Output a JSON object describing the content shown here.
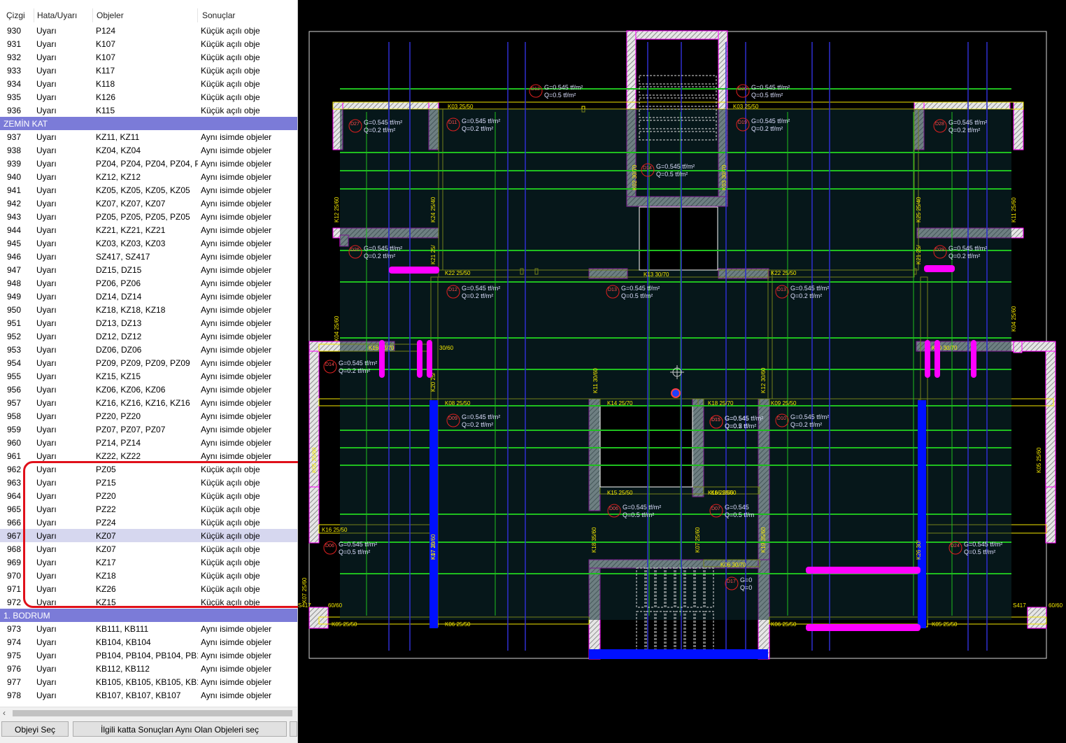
{
  "table": {
    "headers": [
      "Çizgi",
      "Hata/Uyarı",
      "Objeler",
      "Sonuçlar"
    ],
    "rows": [
      {
        "no": "930",
        "type": "Uyarı",
        "objects": "P124",
        "result": "Küçük açılı obje"
      },
      {
        "no": "931",
        "type": "Uyarı",
        "objects": "K107",
        "result": "Küçük açılı obje"
      },
      {
        "no": "932",
        "type": "Uyarı",
        "objects": "K107",
        "result": "Küçük açılı obje"
      },
      {
        "no": "933",
        "type": "Uyarı",
        "objects": "K117",
        "result": "Küçük açılı obje"
      },
      {
        "no": "934",
        "type": "Uyarı",
        "objects": "K118",
        "result": "Küçük açılı obje"
      },
      {
        "no": "935",
        "type": "Uyarı",
        "objects": "K126",
        "result": "Küçük açılı obje"
      },
      {
        "no": "936",
        "type": "Uyarı",
        "objects": "K115",
        "result": "Küçük açılı obje"
      },
      {
        "group": "ZEMİN KAT"
      },
      {
        "no": "937",
        "type": "Uyarı",
        "objects": "KZ11, KZ11",
        "result": "Aynı isimde objeler"
      },
      {
        "no": "938",
        "type": "Uyarı",
        "objects": "KZ04, KZ04",
        "result": "Aynı isimde objeler"
      },
      {
        "no": "939",
        "type": "Uyarı",
        "objects": "PZ04, PZ04, PZ04, PZ04, P...",
        "result": "Aynı isimde objeler"
      },
      {
        "no": "940",
        "type": "Uyarı",
        "objects": "KZ12, KZ12",
        "result": "Aynı isimde objeler"
      },
      {
        "no": "941",
        "type": "Uyarı",
        "objects": "KZ05, KZ05, KZ05, KZ05",
        "result": "Aynı isimde objeler"
      },
      {
        "no": "942",
        "type": "Uyarı",
        "objects": "KZ07, KZ07, KZ07",
        "result": "Aynı isimde objeler"
      },
      {
        "no": "943",
        "type": "Uyarı",
        "objects": "PZ05, PZ05, PZ05, PZ05",
        "result": "Aynı isimde objeler"
      },
      {
        "no": "944",
        "type": "Uyarı",
        "objects": "KZ21, KZ21, KZ21",
        "result": "Aynı isimde objeler"
      },
      {
        "no": "945",
        "type": "Uyarı",
        "objects": "KZ03, KZ03, KZ03",
        "result": "Aynı isimde objeler"
      },
      {
        "no": "946",
        "type": "Uyarı",
        "objects": "SZ417, SZ417",
        "result": "Aynı isimde objeler"
      },
      {
        "no": "947",
        "type": "Uyarı",
        "objects": "DZ15, DZ15",
        "result": "Aynı isimde objeler"
      },
      {
        "no": "948",
        "type": "Uyarı",
        "objects": "PZ06, PZ06",
        "result": "Aynı isimde objeler"
      },
      {
        "no": "949",
        "type": "Uyarı",
        "objects": "DZ14, DZ14",
        "result": "Aynı isimde objeler"
      },
      {
        "no": "950",
        "type": "Uyarı",
        "objects": "KZ18, KZ18, KZ18",
        "result": "Aynı isimde objeler"
      },
      {
        "no": "951",
        "type": "Uyarı",
        "objects": "DZ13, DZ13",
        "result": "Aynı isimde objeler"
      },
      {
        "no": "952",
        "type": "Uyarı",
        "objects": "DZ12, DZ12",
        "result": "Aynı isimde objeler"
      },
      {
        "no": "953",
        "type": "Uyarı",
        "objects": "DZ06, DZ06",
        "result": "Aynı isimde objeler"
      },
      {
        "no": "954",
        "type": "Uyarı",
        "objects": "PZ09, PZ09, PZ09, PZ09",
        "result": "Aynı isimde objeler"
      },
      {
        "no": "955",
        "type": "Uyarı",
        "objects": "KZ15, KZ15",
        "result": "Aynı isimde objeler"
      },
      {
        "no": "956",
        "type": "Uyarı",
        "objects": "KZ06, KZ06, KZ06",
        "result": "Aynı isimde objeler"
      },
      {
        "no": "957",
        "type": "Uyarı",
        "objects": "KZ16, KZ16, KZ16, KZ16",
        "result": "Aynı isimde objeler"
      },
      {
        "no": "958",
        "type": "Uyarı",
        "objects": "PZ20, PZ20",
        "result": "Aynı isimde objeler"
      },
      {
        "no": "959",
        "type": "Uyarı",
        "objects": "PZ07, PZ07, PZ07",
        "result": "Aynı isimde objeler"
      },
      {
        "no": "960",
        "type": "Uyarı",
        "objects": "PZ14, PZ14",
        "result": "Aynı isimde objeler"
      },
      {
        "no": "961",
        "type": "Uyarı",
        "objects": "KZ22, KZ22",
        "result": "Aynı isimde objeler"
      },
      {
        "no": "962",
        "type": "Uyarı",
        "objects": "PZ05",
        "result": "Küçük açılı obje"
      },
      {
        "no": "963",
        "type": "Uyarı",
        "objects": "PZ15",
        "result": "Küçük açılı obje"
      },
      {
        "no": "964",
        "type": "Uyarı",
        "objects": "PZ20",
        "result": "Küçük açılı obje"
      },
      {
        "no": "965",
        "type": "Uyarı",
        "objects": "PZ22",
        "result": "Küçük açılı obje"
      },
      {
        "no": "966",
        "type": "Uyarı",
        "objects": "PZ24",
        "result": "Küçük açılı obje"
      },
      {
        "no": "967",
        "type": "Uyarı",
        "objects": "KZ07",
        "result": "Küçük açılı obje",
        "selected": true
      },
      {
        "no": "968",
        "type": "Uyarı",
        "objects": "KZ07",
        "result": "Küçük açılı obje"
      },
      {
        "no": "969",
        "type": "Uyarı",
        "objects": "KZ17",
        "result": "Küçük açılı obje"
      },
      {
        "no": "970",
        "type": "Uyarı",
        "objects": "KZ18",
        "result": "Küçük açılı obje"
      },
      {
        "no": "971",
        "type": "Uyarı",
        "objects": "KZ26",
        "result": "Küçük açılı obje"
      },
      {
        "no": "972",
        "type": "Uyarı",
        "objects": "KZ15",
        "result": "Küçük açılı obje"
      },
      {
        "group": "1. BODRUM"
      },
      {
        "no": "973",
        "type": "Uyarı",
        "objects": "KB111, KB111",
        "result": "Aynı isimde objeler"
      },
      {
        "no": "974",
        "type": "Uyarı",
        "objects": "KB104, KB104",
        "result": "Aynı isimde objeler"
      },
      {
        "no": "975",
        "type": "Uyarı",
        "objects": "PB104, PB104, PB104, PB1...",
        "result": "Aynı isimde objeler"
      },
      {
        "no": "976",
        "type": "Uyarı",
        "objects": "KB112, KB112",
        "result": "Aynı isimde objeler"
      },
      {
        "no": "977",
        "type": "Uyarı",
        "objects": "KB105, KB105, KB105, KB105",
        "result": "Aynı isimde objeler"
      },
      {
        "no": "978",
        "type": "Uyarı",
        "objects": "KB107, KB107, KB107",
        "result": "Aynı isimde objeler"
      }
    ]
  },
  "scrollbar": {
    "left_arrow": "‹"
  },
  "buttons": {
    "select_object": "Objeyi Seç",
    "select_same_results": "İlgili katta Sonuçları Aynı Olan Objeleri seç"
  },
  "cad": {
    "beams": [
      {
        "name": "K03 25/50",
        "color": "#f4e800"
      },
      {
        "name": "K03 25/50",
        "color": "#f4e800"
      },
      {
        "name": "K22 25/50",
        "color": "#f4e800"
      },
      {
        "name": "K13 30/70",
        "color": "#f4e800"
      },
      {
        "name": "K22 25/50",
        "color": "#f4e800"
      },
      {
        "name": "K16 30/70",
        "color": "#f4e800"
      },
      {
        "name": "30/60",
        "color": "#f4e800"
      },
      {
        "name": "K08 25/50",
        "color": "#f4e800"
      },
      {
        "name": "K14 25/70",
        "color": "#f4e800"
      },
      {
        "name": "K18 25/70",
        "color": "#f4e800"
      },
      {
        "name": "K09 25/50",
        "color": "#f4e800"
      },
      {
        "name": "K15 25/50",
        "color": "#f4e800"
      },
      {
        "name": "K16 25/50",
        "color": "#f4e800"
      },
      {
        "name": "K16 25/50",
        "color": "#f4e800"
      },
      {
        "name": "K16 25/50",
        "color": "#f4e800"
      },
      {
        "name": "K06 30/70",
        "color": "#f4e800"
      },
      {
        "name": "K05 25/50",
        "color": "#f4e800"
      },
      {
        "name": "K06 25/50",
        "color": "#f4e800"
      },
      {
        "name": "K06 25/50",
        "color": "#f4e800"
      },
      {
        "name": "K05 25/50",
        "color": "#f4e800"
      },
      {
        "name": "K30 30/70",
        "color": "#f4e800"
      }
    ],
    "side_labels": [
      {
        "text": "S417"
      },
      {
        "text": "60/60"
      },
      {
        "text": "S417"
      },
      {
        "text": "60/60"
      }
    ],
    "slabs": [
      {
        "id": "D12",
        "g": "G=0.545  tf/m²",
        "q": "Q=0.5  tf/m²"
      },
      {
        "id": "D20",
        "g": "G=0.545  tf/m²",
        "q": "Q=0.5  tf/m²"
      },
      {
        "id": "D27",
        "g": "G=0.545  tf/m²",
        "q": "Q=0.2  tf/m²"
      },
      {
        "id": "D11",
        "g": "G=0.545  tf/m²",
        "q": "Q=0.2  tf/m²"
      },
      {
        "id": "D19",
        "g": "G=0.545  tf/m²",
        "q": "Q=0.2  tf/m²"
      },
      {
        "id": "D28",
        "g": "G=0.545  tf/m²",
        "q": "Q=0.2  tf/m²"
      },
      {
        "id": "D14",
        "g": "G=0.545  tf/m²",
        "q": "Q=0.5  tf/m²"
      },
      {
        "id": "D26",
        "g": "G=0.545  tf/m²",
        "q": "Q=0.2  tf/m²"
      },
      {
        "id": "D29",
        "g": "G=0.545  tf/m²",
        "q": "Q=0.2  tf/m²"
      },
      {
        "id": "D12",
        "g": "G=0.545  tf/m²",
        "q": "Q=0.2  tf/m²"
      },
      {
        "id": "D13",
        "g": "G=0.545  tf/m²",
        "q": "Q=0.5  tf/m²"
      },
      {
        "id": "D13",
        "g": "G=0.545  tf/m²",
        "q": "Q=0.2  tf/m²"
      },
      {
        "id": "D14",
        "g": "G=0.545  tf/m²",
        "q": "Q=0.2  tf/m²"
      },
      {
        "id": "D15",
        "g": "G=0.545  tf/m²",
        "q": "Q=0.2  tf/m²"
      },
      {
        "id": "D09",
        "g": "G=0.545  tf/m²",
        "q": "Q=0.2  tf/m²"
      },
      {
        "id": "D15",
        "g": "G=0.545",
        "q": "Q=0.5  tf/"
      },
      {
        "id": "D10",
        "g": "G=0.545  tf/m²",
        "q": "Q=0.2  tf/m²"
      },
      {
        "id": "D06",
        "g": "G=0.545  tf/m²",
        "q": "Q=0.5  tf/m²"
      },
      {
        "id": "D07",
        "g": "G=0.545",
        "q": "Q=0.5  tf/m"
      },
      {
        "id": "D06",
        "g": "G=0.545  tf/m²",
        "q": "Q=0.5  tf/m²"
      },
      {
        "id": "D24",
        "g": "G=0.545  tf/m²",
        "q": "Q=0.5  tf/m²"
      },
      {
        "id": "D17",
        "g": "G=0",
        "q": "Q=0"
      }
    ],
    "columns": [
      {
        "name": "K12 25/60"
      },
      {
        "name": "K24 25/40"
      },
      {
        "name": "K02 30/70"
      },
      {
        "name": "K03 30/70"
      },
      {
        "name": "K25 25/40"
      },
      {
        "name": "K11 25/60"
      },
      {
        "name": "K21 25/"
      },
      {
        "name": "K21 25/"
      },
      {
        "name": "K04 25/60"
      },
      {
        "name": "K04 25/60"
      },
      {
        "name": "K20 25/"
      },
      {
        "name": "K11 30/60"
      },
      {
        "name": "K12 30/60"
      },
      {
        "name": "K05 25/60"
      },
      {
        "name": "K05 25/60"
      },
      {
        "name": "K18 35/60"
      },
      {
        "name": "K07 25/60"
      },
      {
        "name": "K19 35/60"
      },
      {
        "name": "K07 25/60"
      },
      {
        "name": "K07 25/60"
      },
      {
        "name": "K17 30/"
      },
      {
        "name": "K26 30/"
      }
    ],
    "colors": {
      "background": "#000000",
      "beam": "#f4e800",
      "slab_line": "#1fbf1f",
      "axis": "#2f2fd0",
      "highlight": "#ff00ff",
      "wall": "#ff00ff",
      "error_beam": "#0010ff",
      "panel_group": "#7b7bd8",
      "selection": "#d6d7ef",
      "annotation": "#e0101a"
    }
  }
}
